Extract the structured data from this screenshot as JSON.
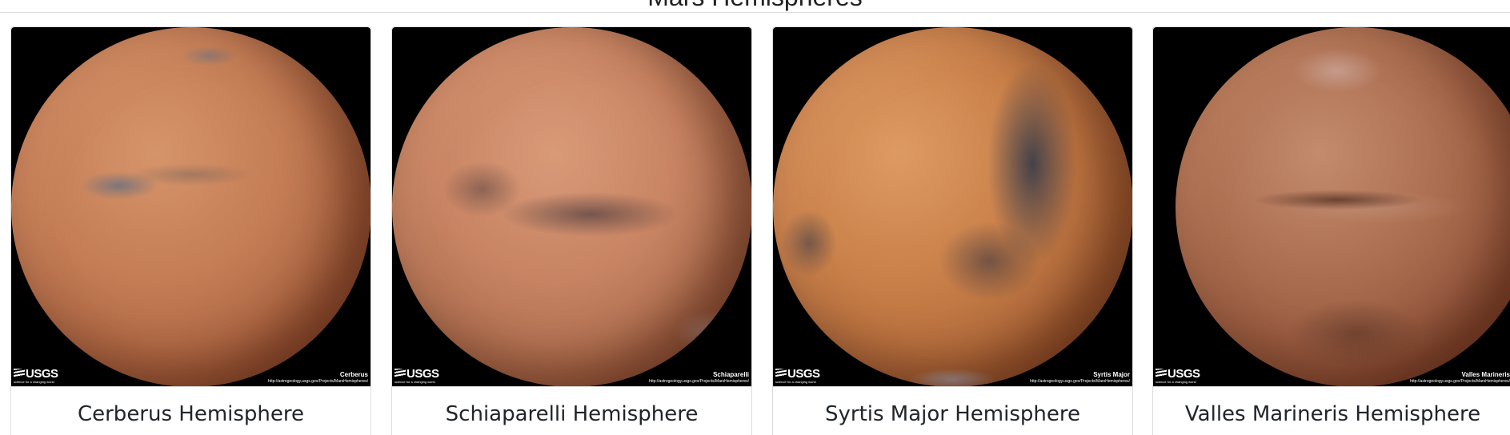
{
  "page": {
    "heading": "Mars Hemispheres"
  },
  "hemispheres": [
    {
      "title": "Cerberus Hemisphere",
      "image_label": "Cerberus",
      "image_url_text": "http://astrogeology.usgs.gov/Projects/MarsHemispheres/",
      "logo": "USGS",
      "logo_tagline": "science for a changing world"
    },
    {
      "title": "Schiaparelli Hemisphere",
      "image_label": "Schiaparelli",
      "image_url_text": "http://astrogeology.usgs.gov/Projects/MarsHemispheres/",
      "logo": "USGS",
      "logo_tagline": "science for a changing world"
    },
    {
      "title": "Syrtis Major Hemisphere",
      "image_label": "Syrtis Major",
      "image_url_text": "http://astrogeology.usgs.gov/Projects/MarsHemispheres/",
      "logo": "USGS",
      "logo_tagline": "science for a changing world"
    },
    {
      "title": "Valles Marineris Hemisphere",
      "image_label": "Valles Marineris",
      "image_url_text": "http://astrogeology.usgs.gov/Projects/MarsHemispheres/",
      "logo": "USGS",
      "logo_tagline": "science for a changing world"
    }
  ]
}
